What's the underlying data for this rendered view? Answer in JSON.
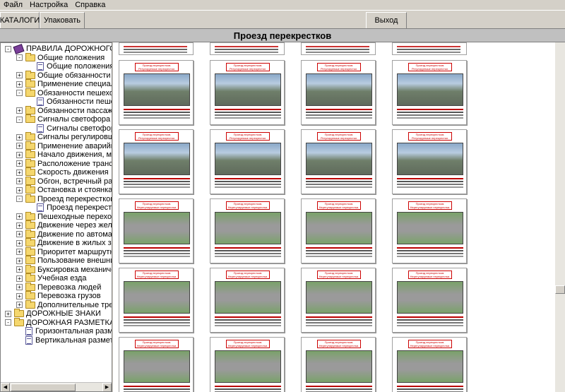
{
  "menu": [
    "Файл",
    "Настройка",
    "Справка"
  ],
  "toolbar": {
    "catalogs": "КАТАЛОГИ",
    "pack": "Упаковать",
    "exit": "Выход"
  },
  "page_title": "Проезд перекрестков",
  "tree": [
    {
      "label": "ПРАВИЛА ДОРОЖНОГО ДВИ",
      "level": 0,
      "kind": "book",
      "exp": "-"
    },
    {
      "label": "Общие положения",
      "level": 1,
      "kind": "folder",
      "exp": "-"
    },
    {
      "label": "Общие положения",
      "level": 2,
      "kind": "doc",
      "exp": ""
    },
    {
      "label": "Общие обязанности водит",
      "level": 1,
      "kind": "folder",
      "exp": "+"
    },
    {
      "label": "Применение специальных",
      "level": 1,
      "kind": "folder",
      "exp": "+"
    },
    {
      "label": "Обязанности пешеходов",
      "level": 1,
      "kind": "folder",
      "exp": "-"
    },
    {
      "label": "Обязанности пешеходо",
      "level": 2,
      "kind": "doc",
      "exp": ""
    },
    {
      "label": "Обязанности пассажиров",
      "level": 1,
      "kind": "folder",
      "exp": "+"
    },
    {
      "label": "Сигналы светофора",
      "level": 1,
      "kind": "folder",
      "exp": "-"
    },
    {
      "label": "Сигналы светофора",
      "level": 2,
      "kind": "doc",
      "exp": ""
    },
    {
      "label": "Сигналы регулировщика",
      "level": 1,
      "kind": "folder",
      "exp": "+"
    },
    {
      "label": "Применение аварийной си",
      "level": 1,
      "kind": "folder",
      "exp": "+"
    },
    {
      "label": "Начало движения, маневр",
      "level": 1,
      "kind": "folder",
      "exp": "+"
    },
    {
      "label": "Расположение транспортн",
      "level": 1,
      "kind": "folder",
      "exp": "+"
    },
    {
      "label": "Скорость движения",
      "level": 1,
      "kind": "folder",
      "exp": "+"
    },
    {
      "label": "Обгон, встречный разъезд",
      "level": 1,
      "kind": "folder",
      "exp": "+"
    },
    {
      "label": "Остановка и стоянка",
      "level": 1,
      "kind": "folder",
      "exp": "+"
    },
    {
      "label": "Проезд перекрестков",
      "level": 1,
      "kind": "folder",
      "exp": "-"
    },
    {
      "label": "Проезд перекрестков",
      "level": 2,
      "kind": "doc",
      "exp": ""
    },
    {
      "label": "Пешеходные переходы и м",
      "level": 1,
      "kind": "folder",
      "exp": "+"
    },
    {
      "label": "Движение через железнод",
      "level": 1,
      "kind": "folder",
      "exp": "+"
    },
    {
      "label": "Движение по автомагистр",
      "level": 1,
      "kind": "folder",
      "exp": "+"
    },
    {
      "label": "Движение в жилых зонах",
      "level": 1,
      "kind": "folder",
      "exp": "+"
    },
    {
      "label": "Приоритет маршрутных тр",
      "level": 1,
      "kind": "folder",
      "exp": "+"
    },
    {
      "label": "Пользование внешними св",
      "level": 1,
      "kind": "folder",
      "exp": "+"
    },
    {
      "label": "Буксировка механических",
      "level": 1,
      "kind": "folder",
      "exp": "+"
    },
    {
      "label": "Учебная езда",
      "level": 1,
      "kind": "folder",
      "exp": "+"
    },
    {
      "label": "Перевозка людей",
      "level": 1,
      "kind": "folder",
      "exp": "+"
    },
    {
      "label": "Перевозка грузов",
      "level": 1,
      "kind": "folder",
      "exp": "+"
    },
    {
      "label": "Дополнительные требован",
      "level": 1,
      "kind": "folder",
      "exp": "+"
    },
    {
      "label": "ДОРОЖНЫЕ ЗНАКИ",
      "level": 0,
      "kind": "folder",
      "exp": "+"
    },
    {
      "label": "ДОРОЖНАЯ РАЗМЕТКА",
      "level": 0,
      "kind": "folder",
      "exp": "-"
    },
    {
      "label": "Горизонтальная разме",
      "level": 1,
      "kind": "doc",
      "exp": ""
    },
    {
      "label": "Вертикальная разметк",
      "level": 1,
      "kind": "doc",
      "exp": ""
    }
  ],
  "gallery": {
    "columns": 4,
    "rows": 5,
    "card_titles": [
      "Проезд перекрестков. Регулируемые перекрестки.",
      "Проезд перекрестков. Нерегулируемые перекрестки."
    ]
  }
}
